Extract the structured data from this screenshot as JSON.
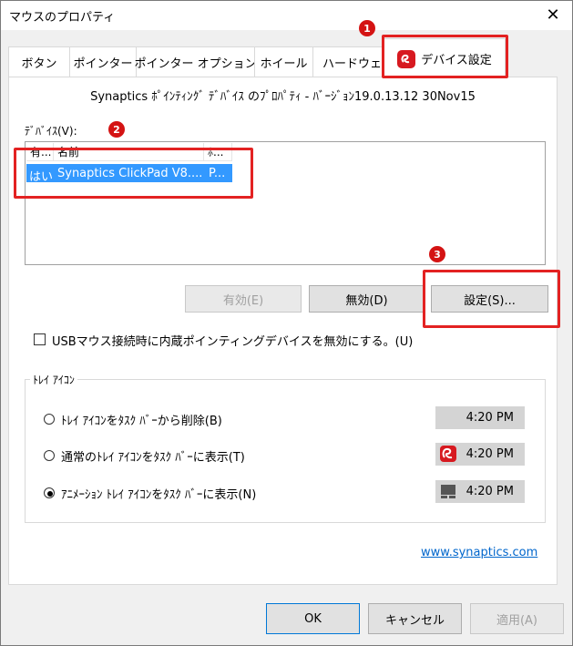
{
  "window": {
    "title": "マウスのプロパティ",
    "close_symbol": "✕"
  },
  "tabs": [
    {
      "label": "ボタン"
    },
    {
      "label": "ポインター"
    },
    {
      "label": "ポインター オプション"
    },
    {
      "label": "ホイール"
    },
    {
      "label": "ハードウェア"
    },
    {
      "label": "デバイス設定",
      "active": true
    }
  ],
  "annotations": [
    "1",
    "2",
    "3"
  ],
  "property_title": "Synaptics ﾎﾟｲﾝﾃｨﾝｸﾞ ﾃﾞﾊﾞｲｽ のﾌﾟﾛﾊﾟﾃｨ - ﾊﾞｰｼﾞｮﾝ19.0.13.12 30Nov15",
  "devices": {
    "label": "ﾃﾞﾊﾞｲｽ(V):",
    "columns": [
      "有...",
      "名前",
      "ﾎ..."
    ],
    "rows": [
      {
        "enabled": "はい",
        "name": "Synaptics ClickPad V8....",
        "port": "P..."
      }
    ]
  },
  "buttons": {
    "enable": "有効(E)",
    "disable": "無効(D)",
    "settings": "設定(S)..."
  },
  "checkbox": {
    "label": "USBマウス接続時に内蔵ポインティングデバイスを無効にする。(U)",
    "checked": false
  },
  "tray_group": {
    "label": "ﾄﾚｲ ｱｲｺﾝ",
    "options": [
      {
        "label": "ﾄﾚｲ ｱｲｺﾝをﾀｽｸ ﾊﾞｰから削除(B)",
        "time": "4:20 PM",
        "selected": false,
        "icon": "none"
      },
      {
        "label": "通常のﾄﾚｲ ｱｲｺﾝをﾀｽｸ ﾊﾞｰに表示(T)",
        "time": "4:20 PM",
        "selected": false,
        "icon": "synaptics-icon"
      },
      {
        "label": "ｱﾆﾒｰｼｮﾝ ﾄﾚｲ ｱｲｺﾝをﾀｽｸ ﾊﾞｰに表示(N)",
        "time": "4:20 PM",
        "selected": true,
        "icon": "animated-touchpad-icon"
      }
    ]
  },
  "link": "www.synaptics.com",
  "footer": {
    "ok": "OK",
    "cancel": "キャンセル",
    "apply": "適用(A)"
  },
  "colors": {
    "accent": "#3399ff",
    "annotation_red": "#e32222",
    "synaptics_red": "#d71920",
    "link": "#0066cc"
  }
}
